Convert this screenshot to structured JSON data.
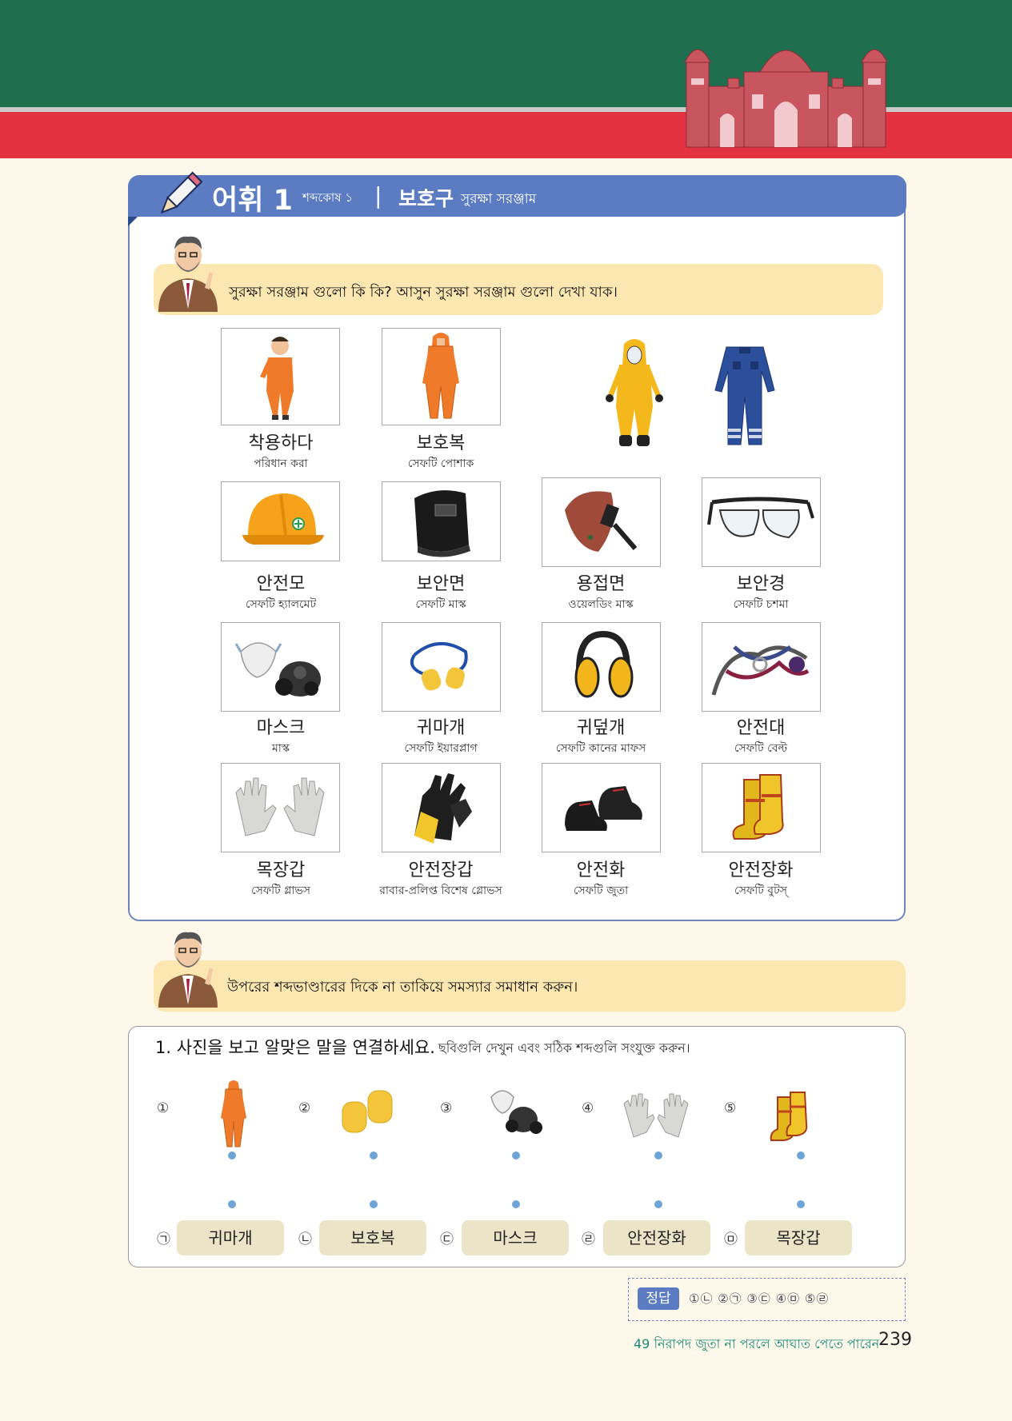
{
  "header": {
    "lesson_title": "어휘 1",
    "lesson_sub": "শব্দকোষ ১",
    "separator": "|",
    "topic": "보호구",
    "topic_sub": "সুরক্ষা সরঞ্জাম"
  },
  "intro_bubble": "সুরক্ষা সরঞ্জাম গুলো কি কি? আসুন সুরক্ষা সরঞ্জাম গুলো দেখা যাক।",
  "vocab": [
    {
      "ko": "착용하다",
      "bn": "পরিধান করা",
      "icon": "worker-putting-on-suit-icon"
    },
    {
      "ko": "보호복",
      "bn": "সেফটি পোশাক",
      "icon": "orange-coverall-icon"
    },
    {
      "ko": "",
      "bn": "",
      "icon": "yellow-hazmat-suit-icon"
    },
    {
      "ko": "",
      "bn": "",
      "icon": "blue-coverall-icon"
    },
    {
      "ko": "안전모",
      "bn": "সেফটি হ্যালমেট",
      "icon": "hard-hat-icon"
    },
    {
      "ko": "보안면",
      "bn": "সেফটি মাস্ক",
      "icon": "face-shield-icon"
    },
    {
      "ko": "용접면",
      "bn": "ওয়েলডিং মাস্ক",
      "icon": "welding-mask-icon"
    },
    {
      "ko": "보안경",
      "bn": "সেফটি চশমা",
      "icon": "safety-glasses-icon"
    },
    {
      "ko": "마스크",
      "bn": "মাস্ক",
      "icon": "respirator-icon"
    },
    {
      "ko": "귀마개",
      "bn": "সেফটি ইয়ারপ্লাগ",
      "icon": "earplugs-icon"
    },
    {
      "ko": "귀덮개",
      "bn": "সেফটি কানের মাফস",
      "icon": "earmuffs-icon"
    },
    {
      "ko": "안전대",
      "bn": "সেফটি বেল্ট",
      "icon": "safety-harness-icon"
    },
    {
      "ko": "목장갑",
      "bn": "সেফটি গ্লাভস",
      "icon": "cotton-gloves-icon"
    },
    {
      "ko": "안전장갑",
      "bn": "রাবার-প্রলিপ্ত বিশেষ গ্লোভস",
      "icon": "rubber-gloves-icon"
    },
    {
      "ko": "안전화",
      "bn": "সেফটি জুতা",
      "icon": "safety-shoes-icon"
    },
    {
      "ko": "안전장화",
      "bn": "সেফটি বুটস্",
      "icon": "safety-boots-icon"
    }
  ],
  "practice_bubble": "উপরের শব্দভাণ্ডারের দিকে না তাকিয়ে সমস্যার সমাধান করুন।",
  "exercise": {
    "title": "1. 사진을 보고 알맞은 말을 연결하세요.",
    "subtitle": "ছবিগুলি দেখুন এবং সঠিক শব্দগুলি সংযুক্ত করুন।",
    "pictures": [
      {
        "num": "①",
        "icon": "orange-coverall-icon"
      },
      {
        "num": "②",
        "icon": "earplugs-icon"
      },
      {
        "num": "③",
        "icon": "respirator-icon"
      },
      {
        "num": "④",
        "icon": "cotton-gloves-icon"
      },
      {
        "num": "⑤",
        "icon": "safety-boots-icon"
      }
    ],
    "words": [
      {
        "num": "㉠",
        "word": "귀마개"
      },
      {
        "num": "㉡",
        "word": "보호복"
      },
      {
        "num": "㉢",
        "word": "마스크"
      },
      {
        "num": "㉣",
        "word": "안전장화"
      },
      {
        "num": "㉤",
        "word": "목장갑"
      }
    ]
  },
  "answer": {
    "label": "정답",
    "text": "①㉡  ②㉠  ③㉢  ④㉤  ⑤㉣"
  },
  "footer": {
    "lesson": "49 নিরাপদ জুতা না পরলে আঘাত পেতে পারেন",
    "page": "239"
  },
  "colors": {
    "green_band": "#1f6e4d",
    "red_band": "#e3323f",
    "header_blue": "#5b7bc2",
    "bubble": "#fde7b0",
    "pill": "#ece4c6",
    "dot": "#6fa4d8"
  }
}
